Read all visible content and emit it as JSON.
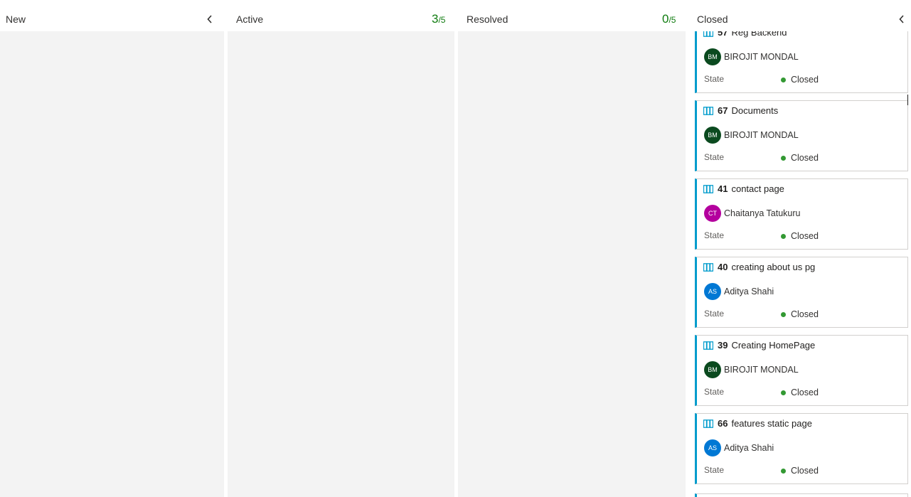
{
  "columns": [
    {
      "title": "New"
    },
    {
      "title": "Active",
      "limit_current": "3",
      "limit_max": "/5"
    },
    {
      "title": "Resolved",
      "limit_current": "0",
      "limit_max": "/5"
    },
    {
      "title": "Closed"
    }
  ],
  "cards": [
    {
      "id": "57",
      "title": "Reg Backend",
      "assignee": "BIROJIT MONDAL",
      "initials": "BM",
      "avatar_color": "#0b4a1f",
      "state_label": "State",
      "state": "Closed"
    },
    {
      "id": "67",
      "title": "Documents",
      "assignee": "BIROJIT MONDAL",
      "initials": "BM",
      "avatar_color": "#0b4a1f",
      "state_label": "State",
      "state": "Closed"
    },
    {
      "id": "41",
      "title": "contact page",
      "assignee": "Chaitanya Tatukuru",
      "initials": "CT",
      "avatar_color": "#b4009e",
      "state_label": "State",
      "state": "Closed"
    },
    {
      "id": "40",
      "title": "creating about us pg",
      "assignee": "Aditya Shahi",
      "initials": "AS",
      "avatar_color": "#0078d4",
      "state_label": "State",
      "state": "Closed"
    },
    {
      "id": "39",
      "title": "Creating HomePage",
      "assignee": "BIROJIT MONDAL",
      "initials": "BM",
      "avatar_color": "#0b4a1f",
      "state_label": "State",
      "state": "Closed"
    },
    {
      "id": "66",
      "title": "features static page",
      "assignee": "Aditya Shahi",
      "initials": "AS",
      "avatar_color": "#0078d4",
      "state_label": "State",
      "state": "Closed"
    }
  ],
  "colors": {
    "card_accent": "#009ccc",
    "state_closed": "#339933",
    "wip_ok": "#107c10"
  },
  "icons": {
    "collapse": "chevron-left-icon",
    "work_item": "book-icon"
  }
}
